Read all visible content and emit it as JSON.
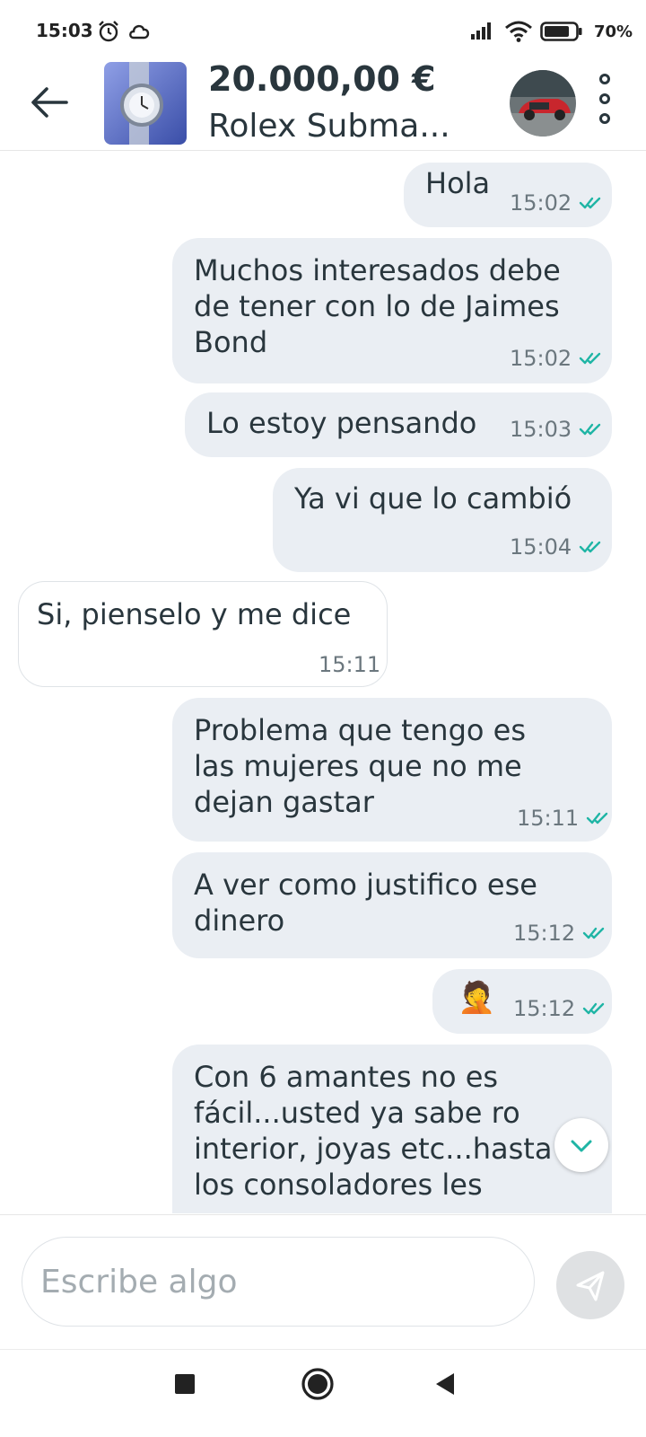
{
  "status_bar": {
    "time": "15:03",
    "battery": "70%"
  },
  "header": {
    "price": "20.000,00 €",
    "title": "Rolex Subma..."
  },
  "messages": [
    {
      "lines": [
        "Hola"
      ],
      "time": "15:02",
      "direction": "out",
      "read": true
    },
    {
      "lines": [
        "Muchos interesados debe",
        "de tener con lo de Jaimes",
        "Bond"
      ],
      "time": "15:02",
      "direction": "out",
      "read": true
    },
    {
      "lines": [
        "Lo estoy pensando"
      ],
      "time": "15:03",
      "direction": "out",
      "read": true
    },
    {
      "lines": [
        "Ya vi que lo cambió"
      ],
      "time": "15:04",
      "direction": "out",
      "read": true
    },
    {
      "lines": [
        "Si, pienselo y me dice"
      ],
      "time": "15:11",
      "direction": "in"
    },
    {
      "lines": [
        "Problema que tengo es",
        "las mujeres que no me",
        "dejan gastar"
      ],
      "time": "15:11",
      "direction": "out",
      "read": true
    },
    {
      "lines": [
        "A ver como justifico ese",
        "dinero"
      ],
      "time": "15:12",
      "direction": "out",
      "read": true
    },
    {
      "emoji": "🤦",
      "time": "15:12",
      "direction": "out",
      "read": true
    },
    {
      "lines": [
        "Con 6 amantes no es",
        "fácil...usted ya sabe ro",
        "interior, joyas etc...hasta",
        "los consoladores les"
      ],
      "direction": "out"
    }
  ],
  "composer": {
    "placeholder": "Escribe algo"
  },
  "colors": {
    "outgoing_bubble": "#eaeef3",
    "read_tick": "#1fb5a5",
    "text": "#29363d"
  }
}
